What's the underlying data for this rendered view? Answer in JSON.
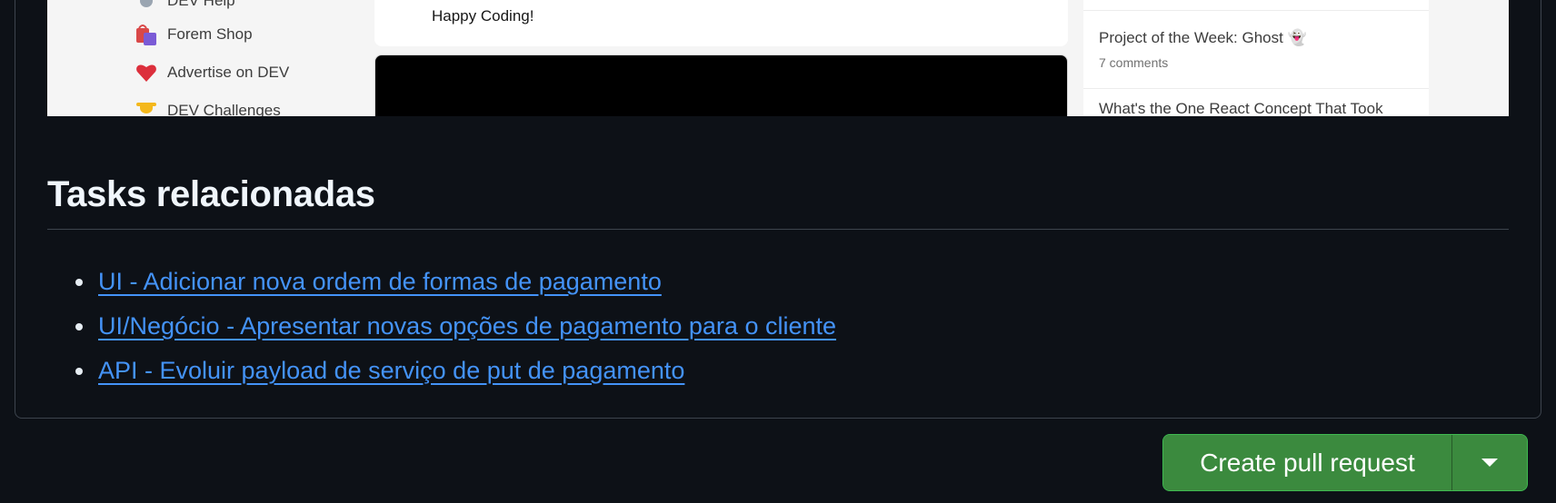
{
  "embedded_screenshot": {
    "sidebar_items": [
      {
        "label": "DEV Help",
        "icon": "help-icon"
      },
      {
        "label": "Forem Shop",
        "icon": "shopping-bags-icon"
      },
      {
        "label": "Advertise on DEV",
        "icon": "heart-icon"
      },
      {
        "label": "DEV Challenges",
        "icon": "trophy-icon"
      }
    ],
    "card_text": "Happy Coding!",
    "right_col": {
      "post_title": "Project of the Week: Ghost 👻",
      "post_meta": "7 comments",
      "next_post_title": "What's the One React Concept That Took"
    }
  },
  "section": {
    "heading": "Tasks relacionadas",
    "tasks": [
      "UI - Adicionar nova ordem de formas de pagamento",
      "UI/Negócio - Apresentar novas opções de pagamento para o cliente",
      "API - Evoluir payload de serviço de put de pagamento"
    ]
  },
  "actions": {
    "create_pr_label": "Create pull request",
    "dropdown_icon": "triangle-down-icon"
  },
  "colors": {
    "background": "#0d1117",
    "link": "#4493f8",
    "button": "#3b8a3e"
  }
}
